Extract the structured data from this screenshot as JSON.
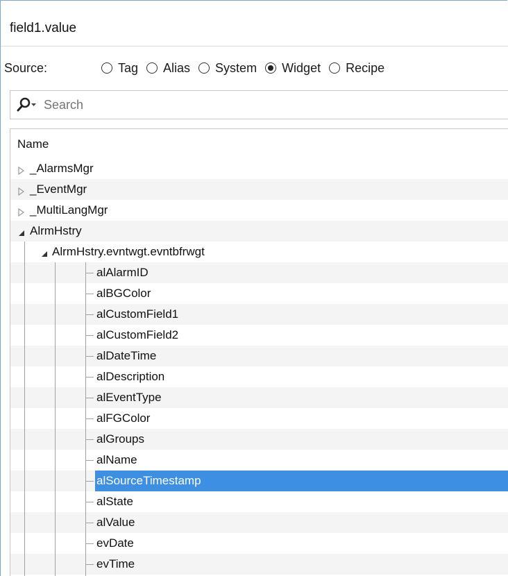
{
  "title": "field1.value",
  "source": {
    "label": "Source:",
    "options": [
      {
        "label": "Tag",
        "checked": false
      },
      {
        "label": "Alias",
        "checked": false
      },
      {
        "label": "System",
        "checked": false
      },
      {
        "label": "Widget",
        "checked": true
      },
      {
        "label": "Recipe",
        "checked": false
      }
    ]
  },
  "search": {
    "placeholder": "Search"
  },
  "tree": {
    "header": "Name",
    "rows": [
      {
        "label": "_AlarmsMgr",
        "level": 0,
        "expander": "collapsed"
      },
      {
        "label": "_EventMgr",
        "level": 0,
        "expander": "collapsed"
      },
      {
        "label": "_MultiLangMgr",
        "level": 0,
        "expander": "collapsed"
      },
      {
        "label": "AlrmHstry",
        "level": 0,
        "expander": "expanded"
      },
      {
        "label": "AlrmHstry.evntwgt.evntbfrwgt",
        "level": 1,
        "expander": "expanded"
      },
      {
        "label": "alAlarmID",
        "level": 2
      },
      {
        "label": "alBGColor",
        "level": 2
      },
      {
        "label": "alCustomField1",
        "level": 2
      },
      {
        "label": "alCustomField2",
        "level": 2
      },
      {
        "label": "alDateTime",
        "level": 2
      },
      {
        "label": "alDescription",
        "level": 2
      },
      {
        "label": "alEventType",
        "level": 2
      },
      {
        "label": "alFGColor",
        "level": 2
      },
      {
        "label": "alGroups",
        "level": 2
      },
      {
        "label": "alName",
        "level": 2
      },
      {
        "label": "alSourceTimestamp",
        "level": 2,
        "selected": true
      },
      {
        "label": "alState",
        "level": 2
      },
      {
        "label": "alValue",
        "level": 2
      },
      {
        "label": "evDate",
        "level": 2
      },
      {
        "label": "evTime",
        "level": 2
      }
    ]
  },
  "colors": {
    "selection": "#3d8fe3",
    "border": "#7aa7d6"
  },
  "icons": {
    "search": "magnifier-dropdown-icon",
    "collapsed": "triangle-right-icon",
    "expanded": "triangle-down-icon"
  }
}
